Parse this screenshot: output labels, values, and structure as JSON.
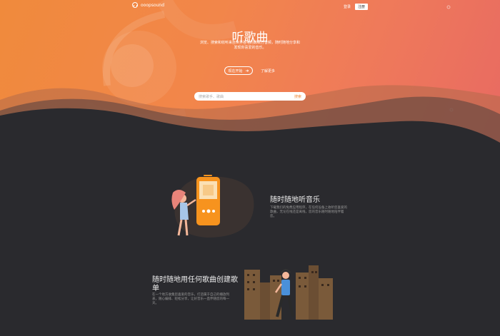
{
  "header": {
    "logo_text": "ooopsound",
    "login_label": "登录",
    "signup_label": "注册"
  },
  "hero": {
    "title": "听歌曲",
    "description": "浏览、搜索和收听来自世界各地的数百万音频，随时随地分享和发现你喜爱的音乐。",
    "start_button": "现在开始",
    "learn_more": "了解更多",
    "search_placeholder": "搜索歌手、歌曲",
    "search_button": "搜索"
  },
  "feature1": {
    "title": "随时随地听音乐",
    "description": "下载我们的免费应用程序，在任何设备上收听您喜爱的歌曲，无论在线还是离线，您的音乐随时随地陪伴着您。"
  },
  "feature2": {
    "title": "随时随地用任何歌曲创建歌单",
    "description": "在一个地方收集您喜爱的音乐，打造属于自己的播放列表，随心编排、轻松分享，让好音乐一直伴随您的每一天。"
  },
  "colors": {
    "hero_start": "#f08a3c",
    "hero_end": "#e86a62",
    "dark_bg": "#2a2a2e",
    "accent": "#f7931e"
  }
}
